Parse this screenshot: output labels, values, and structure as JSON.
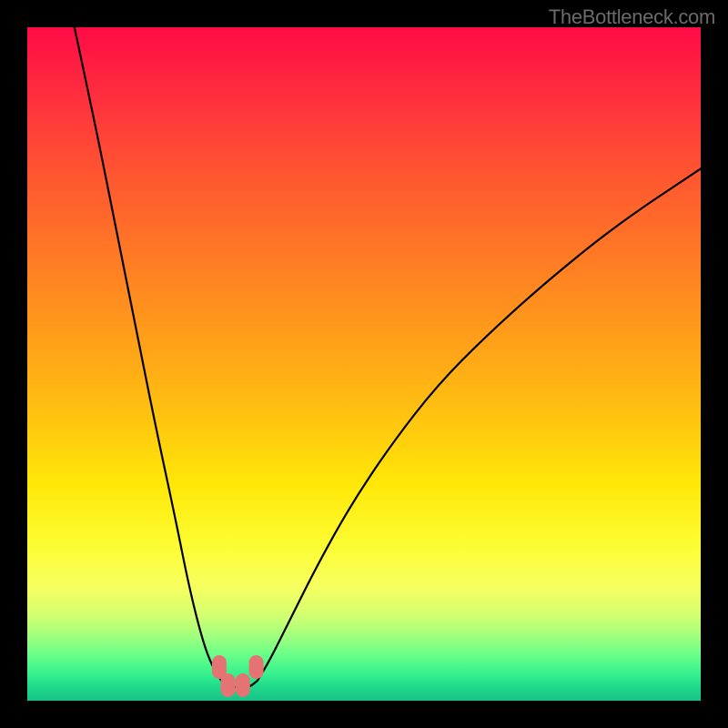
{
  "watermark": "TheBottleneck.com",
  "chart_data": {
    "type": "line",
    "title": "",
    "xlabel": "",
    "ylabel": "",
    "xlim": [
      0,
      100
    ],
    "ylim": [
      0,
      100
    ],
    "grid": false,
    "legend": false,
    "notes": "Vertical gradient background from red (top) to green (bottom). Two black curves descend from the top edge into a flat trough near x≈27–34 at y≈2, then one curve rises to the right edge. Four pink markers sit at the bottom of the trough.",
    "series": [
      {
        "name": "left-branch",
        "x": [
          7,
          10,
          13,
          16,
          19,
          22,
          24,
          26,
          27.5,
          28.8
        ],
        "y": [
          100,
          86,
          71,
          56,
          41,
          27,
          17,
          9,
          5,
          3
        ]
      },
      {
        "name": "trough",
        "x": [
          28.8,
          30.0,
          31.5,
          33.0,
          34.2
        ],
        "y": [
          3,
          2,
          2,
          2,
          3
        ]
      },
      {
        "name": "right-branch",
        "x": [
          34.2,
          36,
          39,
          43,
          48,
          54,
          61,
          69,
          78,
          88,
          100
        ],
        "y": [
          3,
          6,
          12,
          20,
          29,
          38,
          47,
          55,
          63,
          71,
          79
        ]
      }
    ],
    "markers": [
      {
        "x": 28.5,
        "y": 5.0,
        "color": "#e57373"
      },
      {
        "x": 29.8,
        "y": 2.3,
        "color": "#e57373"
      },
      {
        "x": 32.0,
        "y": 2.3,
        "color": "#e57373"
      },
      {
        "x": 34.0,
        "y": 5.0,
        "color": "#e57373"
      }
    ],
    "gradient_stops": [
      {
        "pos": 0.0,
        "color": "#ff0b46"
      },
      {
        "pos": 0.5,
        "color": "#ffb812"
      },
      {
        "pos": 0.8,
        "color": "#fdfd40"
      },
      {
        "pos": 1.0,
        "color": "#18c185"
      }
    ]
  }
}
